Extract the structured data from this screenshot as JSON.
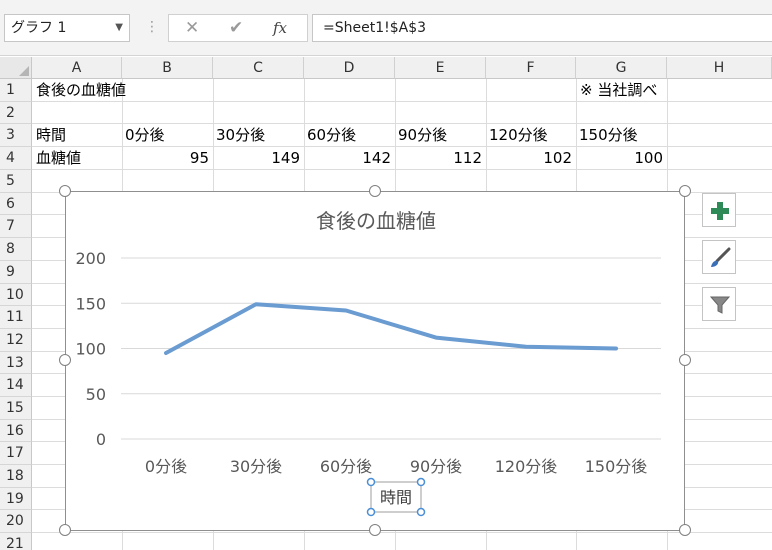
{
  "formula_bar": {
    "name_box": "グラフ 1",
    "formula": "=Sheet1!$A$3"
  },
  "columns": [
    "A",
    "B",
    "C",
    "D",
    "E",
    "F",
    "G",
    "H"
  ],
  "rows": [
    "1",
    "2",
    "3",
    "4",
    "5",
    "6",
    "7",
    "8",
    "9",
    "10",
    "11",
    "12",
    "13",
    "14",
    "15",
    "16",
    "17",
    "18",
    "19",
    "20",
    "21"
  ],
  "cells": {
    "a1": "食後の血糖値",
    "g1": "※ 当社調べ",
    "a3": "時間",
    "b3": "0分後",
    "c3": "30分後",
    "d3": "60分後",
    "e3": "90分後",
    "f3": "120分後",
    "g3": "150分後",
    "a4": "血糖値",
    "b4": "95",
    "c4": "149",
    "d4": "142",
    "e4": "112",
    "f4": "102",
    "g4": "100"
  },
  "chart_data": {
    "type": "line",
    "title": "食後の血糖値",
    "xlabel": "時間",
    "ylabel": "",
    "categories": [
      "0分後",
      "30分後",
      "60分後",
      "90分後",
      "120分後",
      "150分後"
    ],
    "series": [
      {
        "values": [
          95,
          149,
          142,
          112,
          102,
          100
        ]
      }
    ],
    "ylim": [
      0,
      200
    ],
    "yticks": [
      "0",
      "50",
      "100",
      "150",
      "200"
    ],
    "grid": true,
    "legend": "none",
    "line_color": "#6a9bd1"
  },
  "side_buttons": {
    "icons": [
      "plus-icon",
      "brush-icon",
      "filter-icon"
    ],
    "plus_color": "#2e8b57"
  }
}
